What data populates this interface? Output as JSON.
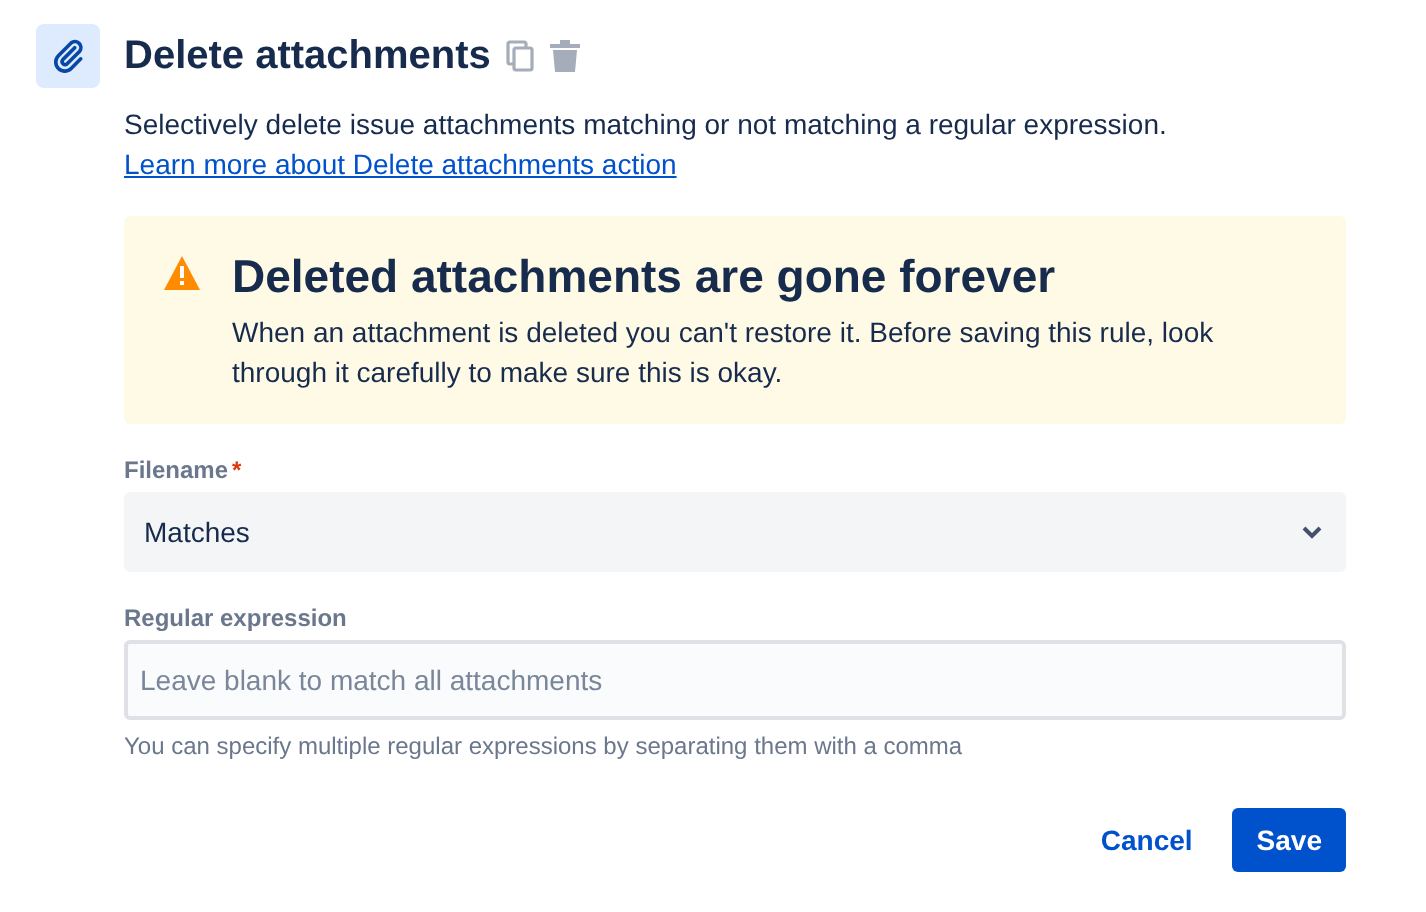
{
  "header": {
    "title": "Delete attachments"
  },
  "description": {
    "text": "Selectively delete issue attachments matching or not matching a regular expression.",
    "link": "Learn more about Delete attachments action"
  },
  "warning": {
    "title": "Deleted attachments are gone forever",
    "body": "When an attachment is deleted you can't restore it. Before saving this rule, look through it carefully to make sure this is okay."
  },
  "fields": [
    {
      "kind": "select",
      "label": "Filename",
      "required_mark": "*",
      "value": "Matches"
    },
    {
      "kind": "text",
      "label": "Regular expression",
      "placeholder": "Leave blank to match all attachments",
      "helper": "You can specify multiple regular expressions by separating them with a comma"
    }
  ],
  "buttons": [
    {
      "label": "Cancel",
      "kind": "subtle"
    },
    {
      "label": "Save",
      "kind": "primary"
    }
  ]
}
